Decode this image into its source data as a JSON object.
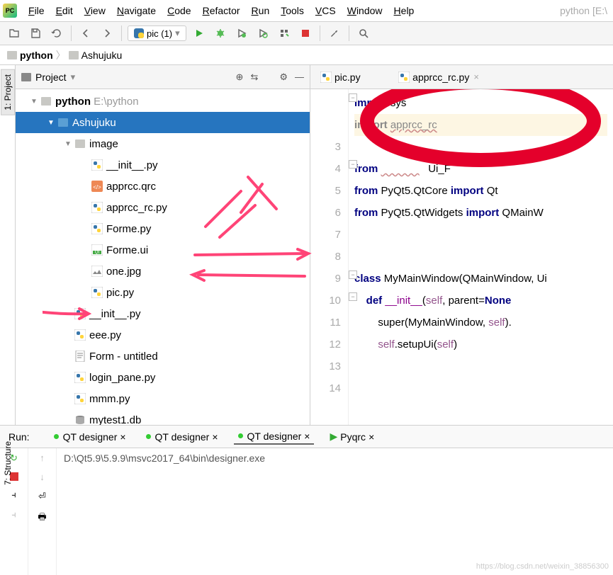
{
  "app": {
    "title_right": "python [E:\\"
  },
  "menu": [
    "File",
    "Edit",
    "View",
    "Navigate",
    "Code",
    "Refactor",
    "Run",
    "Tools",
    "VCS",
    "Window",
    "Help"
  ],
  "run_config": {
    "label": "pic (1)"
  },
  "breadcrumb": {
    "root": "python",
    "child": "Ashujuku"
  },
  "project_panel": {
    "title": "Project"
  },
  "tree": [
    {
      "depth": 0,
      "arrow": "▼",
      "icon": "folder-gray",
      "label": "python",
      "extra": "E:\\python",
      "bold": true
    },
    {
      "depth": 1,
      "arrow": "▼",
      "icon": "folder-blue",
      "label": "Ashujuku",
      "selected": true
    },
    {
      "depth": 2,
      "arrow": "▼",
      "icon": "folder-gray",
      "label": "image"
    },
    {
      "depth": 3,
      "arrow": "",
      "icon": "py",
      "label": "__init__.py"
    },
    {
      "depth": 3,
      "arrow": "",
      "icon": "qrc",
      "label": "apprcc.qrc"
    },
    {
      "depth": 3,
      "arrow": "",
      "icon": "py",
      "label": "apprcc_rc.py"
    },
    {
      "depth": 3,
      "arrow": "",
      "icon": "py",
      "label": "Forme.py"
    },
    {
      "depth": 3,
      "arrow": "",
      "icon": "ui",
      "label": "Forme.ui"
    },
    {
      "depth": 3,
      "arrow": "",
      "icon": "img",
      "label": "one.jpg"
    },
    {
      "depth": 3,
      "arrow": "",
      "icon": "py",
      "label": "pic.py"
    },
    {
      "depth": 2,
      "arrow": "",
      "icon": "py",
      "label": "__init__.py"
    },
    {
      "depth": 2,
      "arrow": "",
      "icon": "py",
      "label": "eee.py"
    },
    {
      "depth": 2,
      "arrow": "",
      "icon": "txt",
      "label": "Form - untitled"
    },
    {
      "depth": 2,
      "arrow": "",
      "icon": "py",
      "label": "login_pane.py"
    },
    {
      "depth": 2,
      "arrow": "",
      "icon": "py",
      "label": "mmm.py"
    },
    {
      "depth": 2,
      "arrow": "",
      "icon": "db",
      "label": "mytest1.db"
    }
  ],
  "editor_tabs": [
    {
      "label": "pic.py",
      "icon": "py",
      "closable": false
    },
    {
      "label": "",
      "icon": "",
      "closable": true,
      "hidden": true
    },
    {
      "label": "apprcc_rc.py",
      "icon": "py",
      "closable": true
    }
  ],
  "code": {
    "lines": [
      {
        "n": "",
        "html": "<span class='kw'>import</span> sys"
      },
      {
        "n": "",
        "html": "<span class='kw dim-text'>import</span> <span class='dim-text squiggle'>apprcc_rc</span>",
        "warn": true
      },
      {
        "n": "3",
        "html": ""
      },
      {
        "n": "4",
        "html": "<span class='kw'>from</span> <span class='squiggle' style='color:#c00'>             </span>   Ui_F"
      },
      {
        "n": "5",
        "html": "<span class='kw'>from</span> PyQt5.QtCore <span class='kw'>import</span> Qt"
      },
      {
        "n": "6",
        "html": "<span class='kw'>from</span> PyQt5.QtWidgets <span class='kw'>import</span> QMainW"
      },
      {
        "n": "7",
        "html": ""
      },
      {
        "n": "8",
        "html": ""
      },
      {
        "n": "9",
        "html": "<span class='kw'>class</span> MyMainWindow(QMainWindow, Ui"
      },
      {
        "n": "10",
        "html": "    <span class='kw'>def</span> <span class='fn'>__init__</span>(<span class='self'>self</span>, parent=<span class='kw'>None</span>"
      },
      {
        "n": "11",
        "html": "        super(MyMainWindow, <span class='self'>self</span>)."
      },
      {
        "n": "12",
        "html": "        <span class='self'>self</span>.setupUi(<span class='self'>self</span>)"
      },
      {
        "n": "13",
        "html": ""
      },
      {
        "n": "14",
        "html": ""
      }
    ]
  },
  "run": {
    "label": "Run:",
    "tabs": [
      {
        "label": "QT designer",
        "active": false
      },
      {
        "label": "QT designer",
        "active": false
      },
      {
        "label": "QT designer",
        "active": true
      },
      {
        "label": "Pyqrc",
        "active": false,
        "play": true
      }
    ],
    "output": "D:\\Qt5.9\\5.9.9\\msvc2017_64\\bin\\designer.exe"
  },
  "vtabs": {
    "project": "1: Project",
    "structure": "7: Structure"
  },
  "watermark": "https://blog.csdn.net/weixin_38856300"
}
